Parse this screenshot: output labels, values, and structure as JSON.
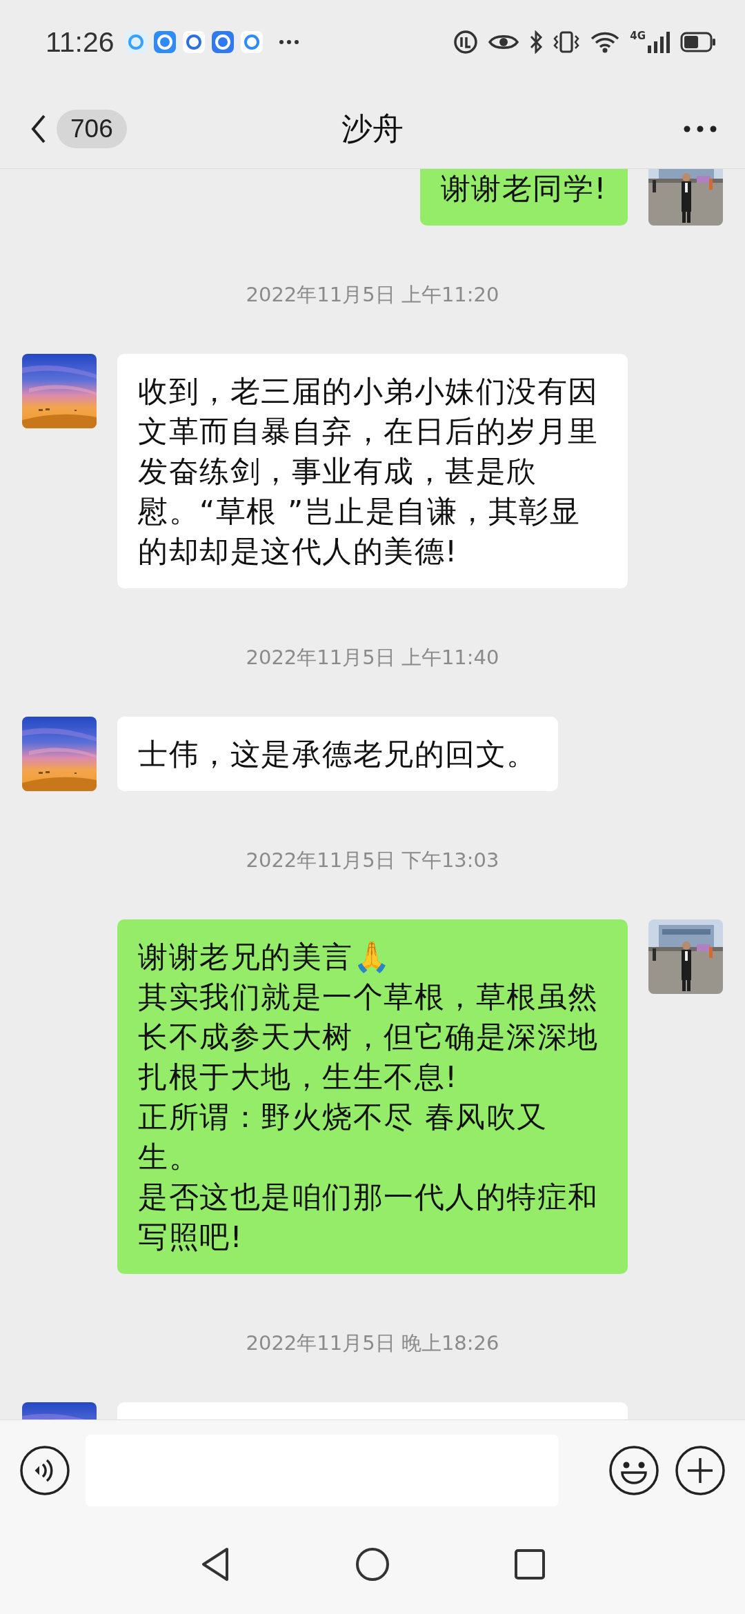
{
  "status_bar": {
    "time": "11:26",
    "network": "4G"
  },
  "header": {
    "unread_count": "706",
    "title": "沙舟"
  },
  "messages": [
    {
      "kind": "sent",
      "paragraphs": [
        "谢谢老同学!"
      ]
    },
    {
      "kind": "time",
      "text": "2022年11月5日 上午11:20"
    },
    {
      "kind": "received",
      "paragraphs": [
        "收到，老三届的小弟小妹们没有因文革而自暴自弃，在日后的岁月里发奋练剑，事业有成，甚是欣慰。“草根 ”岂止是自谦，其彰显的却却是这代人的美德!"
      ]
    },
    {
      "kind": "time",
      "text": "2022年11月5日 上午11:40"
    },
    {
      "kind": "received",
      "paragraphs": [
        "士伟，这是承德老兄的回文。"
      ]
    },
    {
      "kind": "time",
      "text": "2022年11月5日 下午13:03"
    },
    {
      "kind": "sent",
      "paragraphs": [
        "谢谢老兄的美言🙏",
        "其实我们就是一个草根，草根虽然长不成参天大树，但它确是深深地扎根于大地，生生不息!",
        "正所谓：野火烧不尽 春风吹又生。",
        "是否这也是咱们那一代人的特症和写照吧!"
      ]
    },
    {
      "kind": "time",
      "text": "2022年11月5日 晚上18:26"
    },
    {
      "kind": "received"
    }
  ]
}
